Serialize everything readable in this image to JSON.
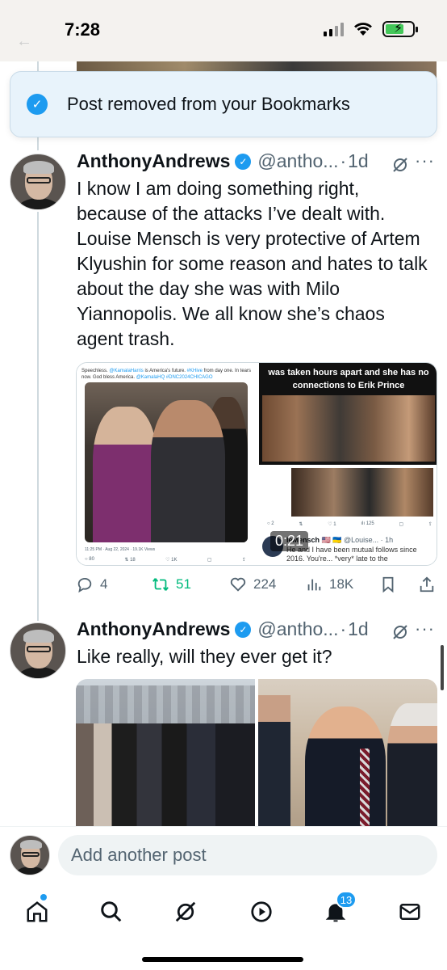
{
  "status_bar": {
    "time": "7:28",
    "battery_charging": true
  },
  "colors": {
    "accent": "#1d9bf0",
    "retweet": "#00ba7c",
    "muted": "#536471"
  },
  "toast": {
    "text": "Post removed from your Bookmarks",
    "icon": "check-circle-icon"
  },
  "posts": [
    {
      "author": "AnthonyAndrews",
      "handle": "@antho...",
      "time": "1d",
      "text": "I know I am doing something right, because of the attacks I’ve dealt with. Louise Mensch is very protective of Artem Klyushin for some reason and hates to talk about the day she was with Milo Yiannopolis. We all know she’s chaos agent trash.",
      "media": {
        "left_caption_a": "Speechless. ",
        "left_caption_link1": "@KamalaHarris",
        "left_caption_b": " is America's future. ",
        "left_caption_link2": "#KHive",
        "left_caption_c": " from day one. In tears now. God bless America. ",
        "left_caption_link3": "@KamalaHQ #DNC2024CHICAGO",
        "left_meta": "11:25 PM · Aug 22, 2024 · 19.1K Views",
        "left_actions": [
          "80",
          "18",
          "1K",
          ""
        ],
        "banner_text": "was taken hours apart and she has no connections to Erik Prince",
        "right_mini_actions": [
          "2",
          "",
          "1",
          "125",
          "",
          ""
        ],
        "quote_name": "ieMensch",
        "quote_flags": "🇺🇸 🇺🇦",
        "quote_handle": "@Louise...",
        "quote_time": "1h",
        "quote_text": "He and I have been mutual follows since 2016. You're... *very* late to the",
        "video_duration": "0:21"
      },
      "actions": {
        "replies": "4",
        "reposts": "51",
        "likes": "224",
        "views": "18K"
      }
    },
    {
      "author": "AnthonyAndrews",
      "handle": "@antho...",
      "time": "1d",
      "text": "Like really, will they ever get it?"
    }
  ],
  "compose": {
    "placeholder": "Add another post"
  },
  "tab_bar": {
    "items": [
      "home-icon",
      "search-icon",
      "grok-icon",
      "video-icon",
      "notifications-icon",
      "messages-icon"
    ],
    "notification_count": "13"
  }
}
